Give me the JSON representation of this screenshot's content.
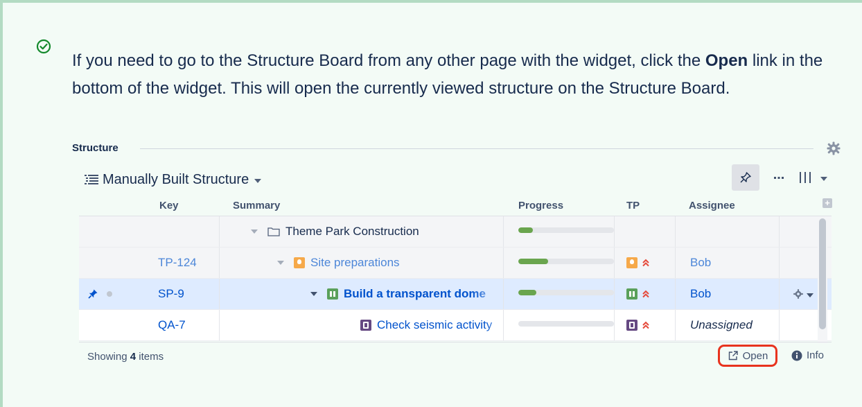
{
  "tip": {
    "text_before": "If you need to go to the Structure Board from any other page with the widget, click the ",
    "bold_word": "Open",
    "text_after": " link in the bottom of the widget. This will open the currently viewed structure on the Structure Board.",
    "icon": "check-circle-icon"
  },
  "widget": {
    "title": "Structure",
    "structure_name": "Manually Built Structure",
    "icons": {
      "settings": "gear-icon",
      "structure_list": "list-icon",
      "pin": "pin-icon",
      "more": "more-icon",
      "columns": "columns-icon"
    },
    "columns": [
      "Key",
      "Summary",
      "Progress",
      "TP",
      "Assignee"
    ],
    "rows": [
      {
        "key": "",
        "summary": "Theme Park Construction",
        "summary_icon": "folder-icon",
        "progress": 0.15,
        "tp_icon": "",
        "assignee": ""
      },
      {
        "key": "TP-124",
        "summary": "Site preparations",
        "summary_icon": "lightbulb-icon",
        "progress": 0.31,
        "tp_icon": "lightbulb-icon",
        "assignee": "Bob"
      },
      {
        "key": "SP-9",
        "summary": "Build a transparent dome",
        "summary_icon": "story-icon",
        "progress": 0.19,
        "tp_icon": "story-icon",
        "assignee": "Bob"
      },
      {
        "key": "QA-7",
        "summary": "Check seismic activity",
        "summary_icon": "task-icon",
        "progress": 0.0,
        "tp_icon": "task-icon",
        "assignee": "Unassigned"
      }
    ],
    "footer": {
      "showing_prefix": "Showing ",
      "count": "4",
      "showing_suffix": " items",
      "open_label": "Open",
      "info_label": "Info"
    },
    "colors": {
      "progress": "#6aa54e",
      "link": "#0052cc",
      "highlight": "#e8331e",
      "priority": "#e5493a"
    }
  }
}
